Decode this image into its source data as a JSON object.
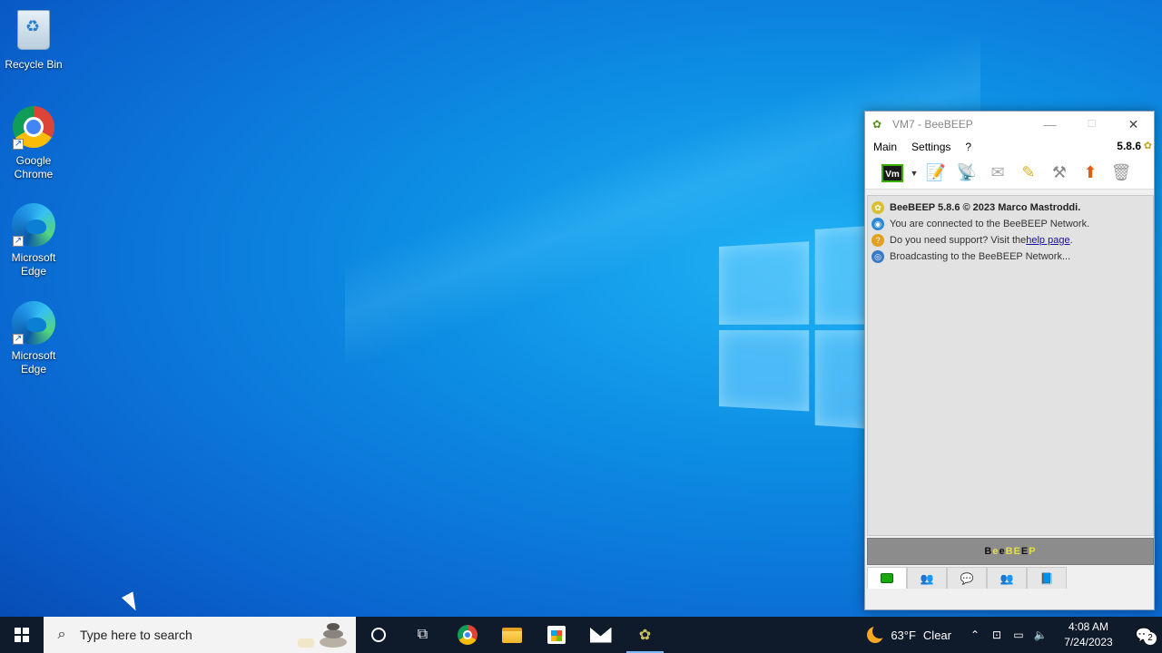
{
  "desktop": {
    "icons": [
      {
        "label": "Recycle Bin"
      },
      {
        "label": "Google Chrome"
      },
      {
        "label": "Microsoft Edge"
      },
      {
        "label": "Microsoft Edge"
      }
    ]
  },
  "window": {
    "title": "VM7 - BeeBEEP",
    "controls": {
      "minimize": "—",
      "maximize": "☐",
      "close": "✕"
    },
    "menu": [
      "Main",
      "Settings",
      "?"
    ],
    "version": "5.8.6",
    "toolbar": {
      "vm_label": "Vm",
      "icons": [
        "profile-icon",
        "broadcast-icon",
        "mail-icon",
        "edit-icon",
        "tools-icon",
        "update-icon",
        "trash-icon"
      ]
    },
    "messages": [
      {
        "text": "BeeBEEP 5.8.6 © 2023 Marco Mastroddi.",
        "bold": true,
        "icon": "bee-icon"
      },
      {
        "text": "You are connected to the BeeBEEP Network.",
        "icon": "network-icon"
      },
      {
        "prefix": "Do you need support? Visit the ",
        "link": "help page",
        "suffix": ".",
        "icon": "help-icon"
      },
      {
        "text": "Broadcasting to the BeeBEEP Network...",
        "icon": "broadcast-icon"
      }
    ],
    "banner_letters": [
      "B",
      "e",
      "e",
      "B",
      "E",
      "E",
      "P"
    ],
    "tabs": [
      "chat-tab",
      "users-tab",
      "groups-tab",
      "network-tab",
      "log-tab"
    ]
  },
  "taskbar": {
    "search_placeholder": "Type here to search",
    "weather": {
      "temp": "63°F",
      "condition": "Clear"
    },
    "clock": {
      "time": "4:08 AM",
      "date": "7/24/2023"
    },
    "notifications": "2"
  },
  "colors": {
    "accent": "#0a64cf",
    "taskbar": "#0f1b2b",
    "link": "#1a0dab"
  }
}
